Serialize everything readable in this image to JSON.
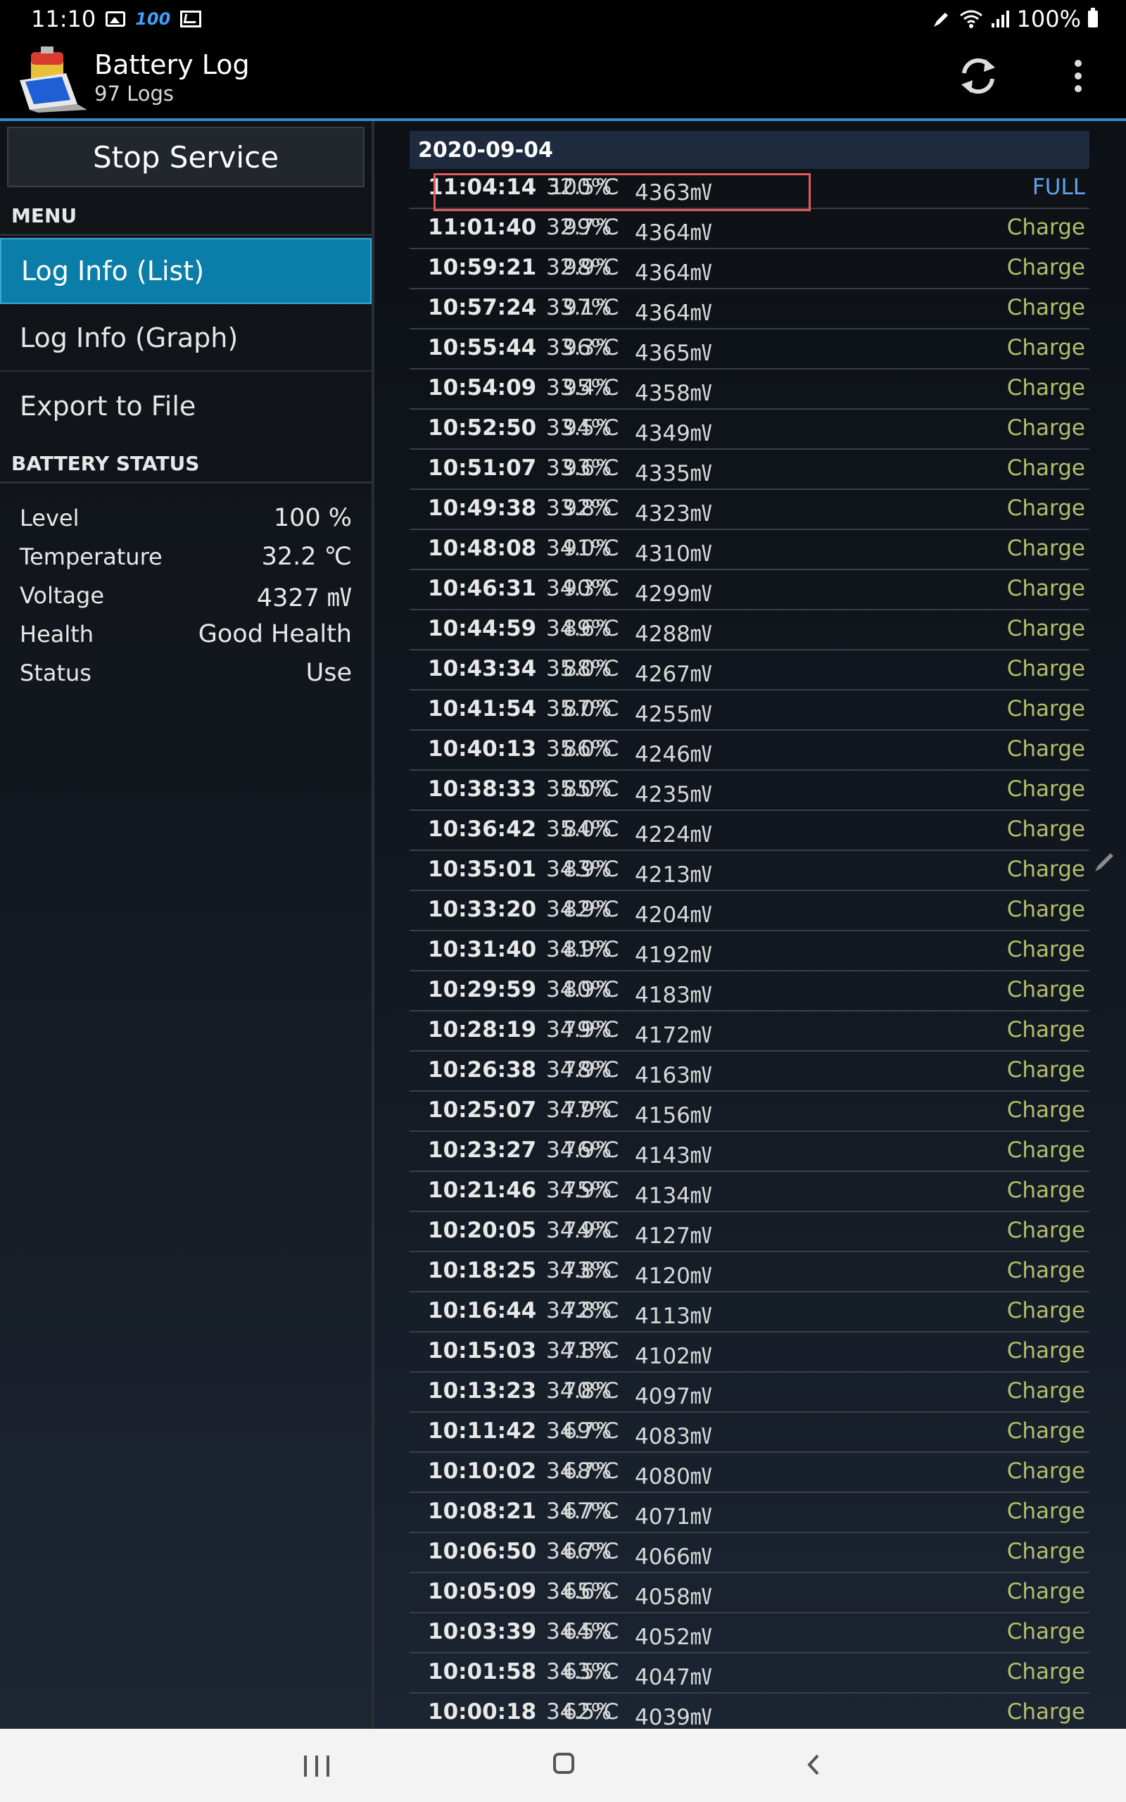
{
  "status_bar": {
    "time": "11:10",
    "indicator_100": "100",
    "battery_text": "100%"
  },
  "app_bar": {
    "title": "Battery Log",
    "subtitle": "97 Logs"
  },
  "sidebar": {
    "stop_service_label": "Stop Service",
    "menu_header": "MENU",
    "menu_items": [
      {
        "label": "Log Info (List)",
        "active": true
      },
      {
        "label": "Log Info (Graph)",
        "active": false
      },
      {
        "label": "Export to File",
        "active": false
      }
    ],
    "battery_status_header": "BATTERY STATUS",
    "battery_status": [
      {
        "label": "Level",
        "value": "100 %"
      },
      {
        "label": "Temperature",
        "value": "32.2 ℃"
      },
      {
        "label": "Voltage",
        "value": "4327 ㎷"
      },
      {
        "label": "Health",
        "value": "Good Health"
      },
      {
        "label": "Status",
        "value": "Use"
      }
    ]
  },
  "log": {
    "date": "2020-09-04",
    "rows": [
      {
        "time": "11:04:14",
        "pct": "100%",
        "temp": "32.5℃",
        "mv": "4363㎷",
        "state": "FULL"
      },
      {
        "time": "11:01:40",
        "pct": "99%",
        "temp": "32.7℃",
        "mv": "4364㎷",
        "state": "Charge"
      },
      {
        "time": "10:59:21",
        "pct": "98%",
        "temp": "32.9℃",
        "mv": "4364㎷",
        "state": "Charge"
      },
      {
        "time": "10:57:24",
        "pct": "97%",
        "temp": "33.1℃",
        "mv": "4364㎷",
        "state": "Charge"
      },
      {
        "time": "10:55:44",
        "pct": "96%",
        "temp": "33.3℃",
        "mv": "4365㎷",
        "state": "Charge"
      },
      {
        "time": "10:54:09",
        "pct": "95%",
        "temp": "33.4℃",
        "mv": "4358㎷",
        "state": "Charge"
      },
      {
        "time": "10:52:50",
        "pct": "94%",
        "temp": "33.5℃",
        "mv": "4349㎷",
        "state": "Charge"
      },
      {
        "time": "10:51:07",
        "pct": "93%",
        "temp": "33.6℃",
        "mv": "4335㎷",
        "state": "Charge"
      },
      {
        "time": "10:49:38",
        "pct": "92%",
        "temp": "33.8℃",
        "mv": "4323㎷",
        "state": "Charge"
      },
      {
        "time": "10:48:08",
        "pct": "91%",
        "temp": "34.0℃",
        "mv": "4310㎷",
        "state": "Charge"
      },
      {
        "time": "10:46:31",
        "pct": "90%",
        "temp": "34.3℃",
        "mv": "4299㎷",
        "state": "Charge"
      },
      {
        "time": "10:44:59",
        "pct": "89%",
        "temp": "34.6℃",
        "mv": "4288㎷",
        "state": "Charge"
      },
      {
        "time": "10:43:34",
        "pct": "88%",
        "temp": "35.0℃",
        "mv": "4267㎷",
        "state": "Charge"
      },
      {
        "time": "10:41:54",
        "pct": "87%",
        "temp": "35.0℃",
        "mv": "4255㎷",
        "state": "Charge"
      },
      {
        "time": "10:40:13",
        "pct": "86%",
        "temp": "35.0℃",
        "mv": "4246㎷",
        "state": "Charge"
      },
      {
        "time": "10:38:33",
        "pct": "85%",
        "temp": "35.0℃",
        "mv": "4235㎷",
        "state": "Charge"
      },
      {
        "time": "10:36:42",
        "pct": "84%",
        "temp": "35.0℃",
        "mv": "4224㎷",
        "state": "Charge"
      },
      {
        "time": "10:35:01",
        "pct": "83%",
        "temp": "34.9℃",
        "mv": "4213㎷",
        "state": "Charge"
      },
      {
        "time": "10:33:20",
        "pct": "82%",
        "temp": "34.9℃",
        "mv": "4204㎷",
        "state": "Charge"
      },
      {
        "time": "10:31:40",
        "pct": "81%",
        "temp": "34.9℃",
        "mv": "4192㎷",
        "state": "Charge"
      },
      {
        "time": "10:29:59",
        "pct": "80%",
        "temp": "34.9℃",
        "mv": "4183㎷",
        "state": "Charge"
      },
      {
        "time": "10:28:19",
        "pct": "79%",
        "temp": "34.9℃",
        "mv": "4172㎷",
        "state": "Charge"
      },
      {
        "time": "10:26:38",
        "pct": "78%",
        "temp": "34.9℃",
        "mv": "4163㎷",
        "state": "Charge"
      },
      {
        "time": "10:25:07",
        "pct": "77%",
        "temp": "34.9℃",
        "mv": "4156㎷",
        "state": "Charge"
      },
      {
        "time": "10:23:27",
        "pct": "76%",
        "temp": "34.9℃",
        "mv": "4143㎷",
        "state": "Charge"
      },
      {
        "time": "10:21:46",
        "pct": "75%",
        "temp": "34.9℃",
        "mv": "4134㎷",
        "state": "Charge"
      },
      {
        "time": "10:20:05",
        "pct": "74%",
        "temp": "34.9℃",
        "mv": "4127㎷",
        "state": "Charge"
      },
      {
        "time": "10:18:25",
        "pct": "73%",
        "temp": "34.8℃",
        "mv": "4120㎷",
        "state": "Charge"
      },
      {
        "time": "10:16:44",
        "pct": "72%",
        "temp": "34.8℃",
        "mv": "4113㎷",
        "state": "Charge"
      },
      {
        "time": "10:15:03",
        "pct": "71%",
        "temp": "34.8℃",
        "mv": "4102㎷",
        "state": "Charge"
      },
      {
        "time": "10:13:23",
        "pct": "70%",
        "temp": "34.8℃",
        "mv": "4097㎷",
        "state": "Charge"
      },
      {
        "time": "10:11:42",
        "pct": "69%",
        "temp": "34.7℃",
        "mv": "4083㎷",
        "state": "Charge"
      },
      {
        "time": "10:10:02",
        "pct": "68%",
        "temp": "34.7℃",
        "mv": "4080㎷",
        "state": "Charge"
      },
      {
        "time": "10:08:21",
        "pct": "67%",
        "temp": "34.7℃",
        "mv": "4071㎷",
        "state": "Charge"
      },
      {
        "time": "10:06:50",
        "pct": "66%",
        "temp": "34.7℃",
        "mv": "4066㎷",
        "state": "Charge"
      },
      {
        "time": "10:05:09",
        "pct": "65%",
        "temp": "34.6℃",
        "mv": "4058㎷",
        "state": "Charge"
      },
      {
        "time": "10:03:39",
        "pct": "64%",
        "temp": "34.5℃",
        "mv": "4052㎷",
        "state": "Charge"
      },
      {
        "time": "10:01:58",
        "pct": "63%",
        "temp": "34.5℃",
        "mv": "4047㎷",
        "state": "Charge"
      },
      {
        "time": "10:00:18",
        "pct": "62%",
        "temp": "34.5℃",
        "mv": "4039㎷",
        "state": "Charge"
      }
    ]
  },
  "colors": {
    "accent": "#0a7ea8",
    "charge_text": "#b4be6a",
    "full_text": "#62a4e8",
    "highlight_border": "#e15a5a"
  },
  "icons": [
    "image-icon",
    "mail-icon",
    "pen-icon",
    "wifi-icon",
    "signal-icon",
    "battery-icon",
    "refresh-icon",
    "more-vert-icon",
    "edit-icon",
    "nav-recents-icon",
    "nav-home-icon",
    "nav-back-icon"
  ]
}
